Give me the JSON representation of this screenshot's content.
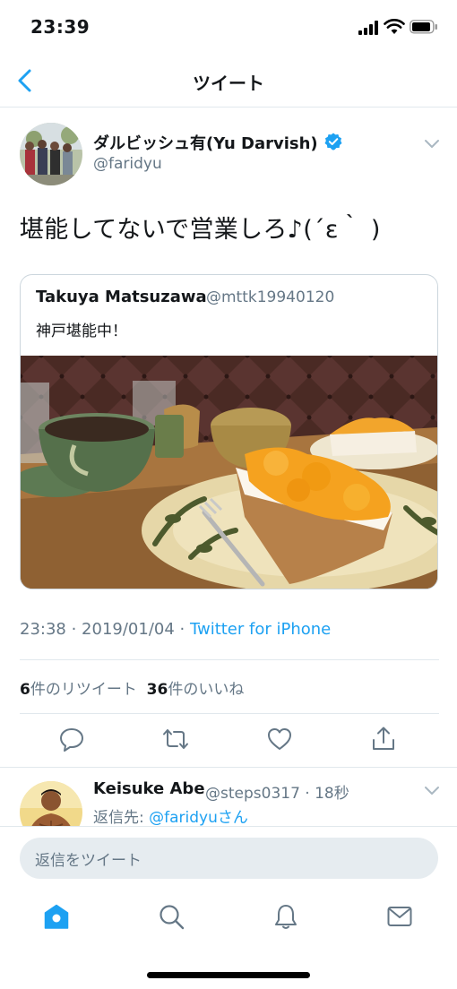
{
  "status_bar": {
    "time": "23:39"
  },
  "nav": {
    "title": "ツイート"
  },
  "tweet": {
    "author_name": "ダルビッシュ有(Yu Darvish)",
    "author_handle": "@faridyu",
    "text": "堪能してないで営業しろ♪(´ε｀ )",
    "timestamp": "23:38 · 2019/01/04 · ",
    "source": "Twitter for iPhone",
    "retweet_count": "6",
    "retweet_label": "件のリツイート",
    "like_count": "36",
    "like_label": "件のいいね"
  },
  "quoted_tweet": {
    "author_name": "Takuya Matsuzawa",
    "author_handle": "@mttk19940120",
    "text": "神戸堪能中！"
  },
  "reply": {
    "author_name": "Keisuke Abe",
    "author_handle": "@steps0317 · 18秒",
    "reply_prefix": "返信先: ",
    "reply_target": "@faridyuさん"
  },
  "composer": {
    "placeholder": "返信をツイート"
  },
  "colors": {
    "accent": "#1da1f2",
    "secondary_text": "#657786",
    "divider": "#e1e8ed"
  }
}
